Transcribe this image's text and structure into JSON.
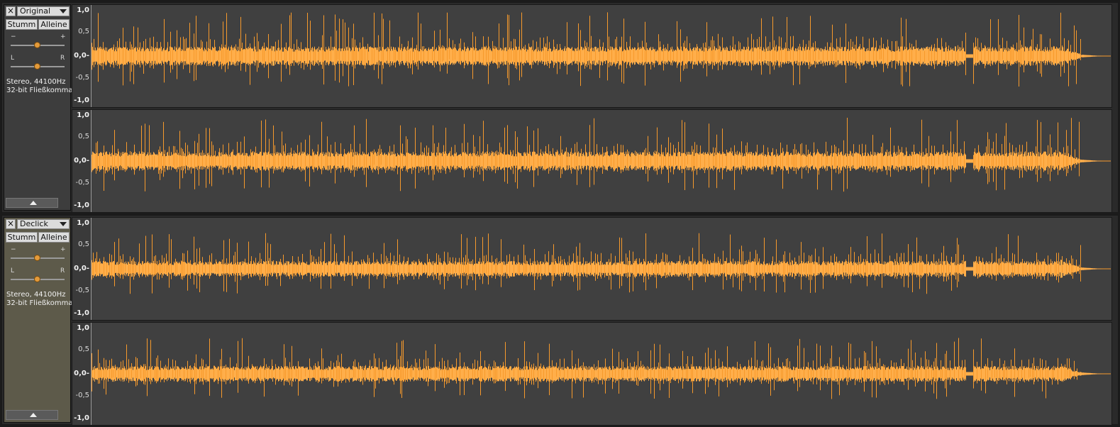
{
  "tracks": [
    {
      "name": "Original",
      "mute_label": "Stumm",
      "solo_label": "Alleine",
      "gain_minus": "−",
      "gain_plus": "+",
      "pan_left": "L",
      "pan_right": "R",
      "info_line1": "Stereo, 44100Hz",
      "info_line2": "32-bit Fließkomma"
    },
    {
      "name": "Declick",
      "mute_label": "Stumm",
      "solo_label": "Alleine",
      "gain_minus": "−",
      "gain_plus": "+",
      "pan_left": "L",
      "pan_right": "R",
      "info_line1": "Stereo, 44100Hz",
      "info_line2": "32-bit Fließkomma"
    }
  ],
  "ruler_ticks": [
    "1,0",
    "0,5",
    "0,0-",
    "-0,5",
    "-1,0"
  ],
  "colors": {
    "waveform": "#f79a2c",
    "waveform_body": "#ffae4a",
    "background": "#404040"
  }
}
